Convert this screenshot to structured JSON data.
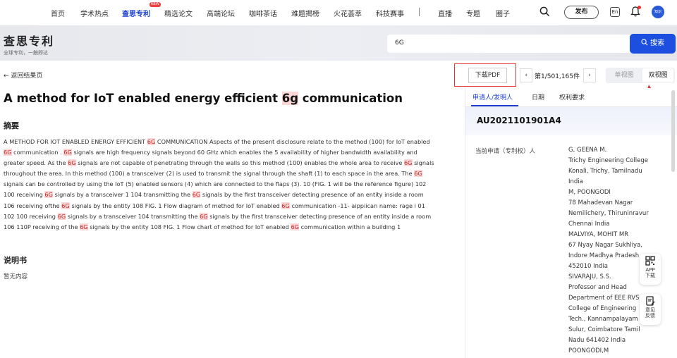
{
  "nav": {
    "items": [
      "首页",
      "学术热点",
      "查思专利",
      "精选论文",
      "高端论坛",
      "咖啡茶话",
      "难题揭榜",
      "火花荟萃",
      "科技赛事",
      "直播",
      "专题",
      "圈子"
    ],
    "new_badge": "NEW",
    "publish": "发布",
    "lang": "En",
    "avatar_text": "知识"
  },
  "banner": {
    "title": "查思专利",
    "subtitle": "全球专利，一触即达",
    "search_value": "6G",
    "search_button": "搜索"
  },
  "toolbar": {
    "back": "返回结果页",
    "download_pdf": "下载PDF",
    "pager": "第1/501,165件",
    "single_view": "单视图",
    "double_view": "双视图"
  },
  "doc": {
    "title_before": "A method for IoT enabled energy efficient ",
    "title_hl": "6g",
    "title_after": " communication",
    "abstract_heading": "摘要",
    "abstract_segments": [
      "A METHOD FOR IOT ENABLED ENERGY EFFICIENT ",
      "6G",
      " COMMUNICATION Aspects of the present disclosure relate to the method (100) for IoT enabled ",
      "6G",
      " communication . ",
      "6G",
      " signals are high frequency signals beyond 60 GHz which enables the 5 availability of higher bandwidth availability and greater speed. As the ",
      "6G",
      " signals are not capable of penetrating through the walls so this method (100) enables the whole area to receive ",
      "6G",
      " signals throughout the area. In this method (100) a transceiver (2) is used to transmit the signal through the shaft (1) to each space in the area. The ",
      "6G",
      " signals can be controlled by using the IoT (5) enabled sensors (4) which are connected to the flaps (3). 10 (FIG. 1 will be the reference figure) 102 100 receiving ",
      "6G",
      " signals by a transceiver 1 104 transmitting the ",
      "6G",
      " signals by the first transceiver detecting presence of an entity inside a room 106 receiving ofthe ",
      "6G",
      " signals by the entity 108 FIG. 1 Flow diagram of method for IoT enabled ",
      "6G",
      " communication -11- aippiican name: rage i 01 102 100 receiving ",
      "6G",
      " signals by a transceiver 104 transmitting the ",
      "6G",
      " signals by the first transceiver detecting presence of an entity inside a room 106 110P receiving of the ",
      "6G",
      " signals by the entity 108 FIG. 1 Flow chart of method for IoT enabled ",
      "6G",
      " communication within a building 1"
    ],
    "description_heading": "说明书",
    "description_empty": "暂无内容"
  },
  "panel": {
    "tabs": [
      "申请人/发明人",
      "日期",
      "权利要求"
    ],
    "pub_number": "AU2021101901A4",
    "applicant_label": "当前申请（专利权）人",
    "applicants": [
      "G, GEENA M.",
      "Trichy Engineering College",
      "Konali, Trichy, Tamilnadu",
      "India",
      "M, POONGODI",
      "78 Mahadevan Nagar",
      "Nemilichery, Thiruninravur",
      "Chennai India",
      "MALVIYA, MOHIT MR",
      "67 Nyay Nagar Sukhliya,",
      "Indore Madhya Pradesh",
      "452010 India",
      "SIVARAJU, S.S.",
      "Professor and Head",
      "Department of EEE RVS",
      "College of Engineering",
      "Tech., Kannampalayam",
      "Sulur, Coimbatore Tamil",
      "Nadu 641402 India",
      "POONGODI,M"
    ]
  },
  "float": {
    "app_download": [
      "APP",
      "下载"
    ],
    "feedback": [
      "意见",
      "反馈"
    ]
  },
  "colors": {
    "accent": "#1c4fe0",
    "highlight_bg": "#fdd7d7",
    "annotation_red": "#e53535"
  }
}
